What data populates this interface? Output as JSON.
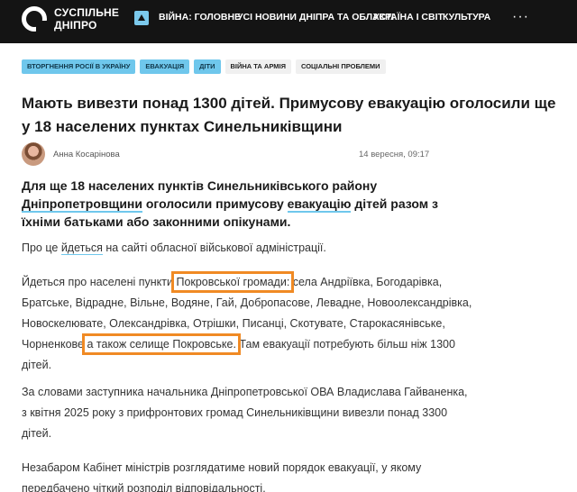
{
  "header": {
    "logo_line1": "СУСПІЛЬНЕ",
    "logo_line2": "ДНІПРО",
    "nav": [
      "ВІЙНА: ГОЛОВНЕ",
      "УСІ НОВИНИ ДНІПРА ТА ОБЛАСТІ",
      "УКРАЇНА І СВІТ",
      "КУЛЬТУРА"
    ],
    "more": "···"
  },
  "tags": [
    "ВТОРГНЕННЯ РОСІЇ В УКРАЇНУ",
    "ЕВАКУАЦІЯ",
    "ДІТИ",
    "ВІЙНА ТА АРМІЯ",
    "СОЦІАЛЬНІ ПРОБЛЕМИ"
  ],
  "article": {
    "title": "Мають вивезти понад 1300 дітей. Примусову евакуацію оголосили ще у 18 населених пунктах Синельниківщини",
    "author": "Анна Косарінова",
    "date": "14 вересня, 09:17",
    "lead": {
      "p1": "Для ще 18 населених пунктів Синельниківського району ",
      "link1": "Дніпропетровщини",
      "p2": " оголосили примусову ",
      "link2": "евакуацію",
      "p3": " дітей разом з їхніми батьками або законними опікунами."
    },
    "source": {
      "p1": "Про це ",
      "link": "йдеться",
      "p2": " на сайті обласної військової адміністрації."
    },
    "villages": {
      "p1": "Йдеться про населені пункти ",
      "hl1": "Покровської громади:",
      "p2": " села Андріївка, Богодарівка, Братське, Відрадне, Вільне, Водяне, Гай, Добропасове, Левадне, Новоолександрівка, Новоскелювате, Олександрівка, Отрішки, Писанці, Скотувате, Старокасянівське, Чорненкове ",
      "hl2": "а також селище Покровське.",
      "p3": " Там евакуації потребують більш ніж 1300 дітей."
    },
    "para3": "За словами заступника начальника Дніпропетровської ОВА Владислава Гайваненка, з квітня 2025 року з прифронтових громад Синельниківщини вивезли понад 3300 дітей.",
    "para4": "Незабаром Кабінет міністрів розглядатиме новий порядок евакуації, у якому передбачено чіткий розподіл відповідальності."
  },
  "colors": {
    "header_bg": "#141414",
    "tag_blue": "#6fc7ec",
    "link_underline": "#6fc7ec",
    "highlight": "#f08a24"
  }
}
